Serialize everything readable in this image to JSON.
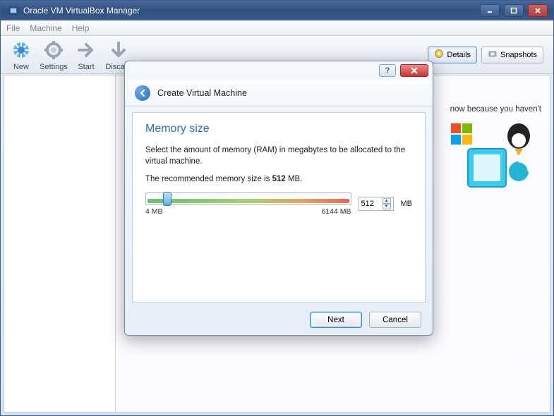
{
  "window": {
    "title": "Oracle VM VirtualBox Manager"
  },
  "menubar": {
    "file": "File",
    "machine": "Machine",
    "help": "Help"
  },
  "toolbar": {
    "new": "New",
    "settings": "Settings",
    "start": "Start",
    "discard": "Discard",
    "details": "Details",
    "snapshots": "Snapshots"
  },
  "content": {
    "hint_fragment": "now because you haven't"
  },
  "dialog": {
    "title": "Create Virtual Machine",
    "section_title": "Memory size",
    "desc": "Select the amount of memory (RAM) in megabytes to be allocated to the virtual machine.",
    "recommend_prefix": "The recommended memory size is ",
    "recommend_value": "512",
    "recommend_suffix": " MB.",
    "slider_min_label": "4 MB",
    "slider_max_label": "6144 MB",
    "value": "512",
    "unit": "MB",
    "slider_min": 4,
    "slider_max": 6144,
    "next": "Next",
    "cancel": "Cancel",
    "help_symbol": "?"
  }
}
